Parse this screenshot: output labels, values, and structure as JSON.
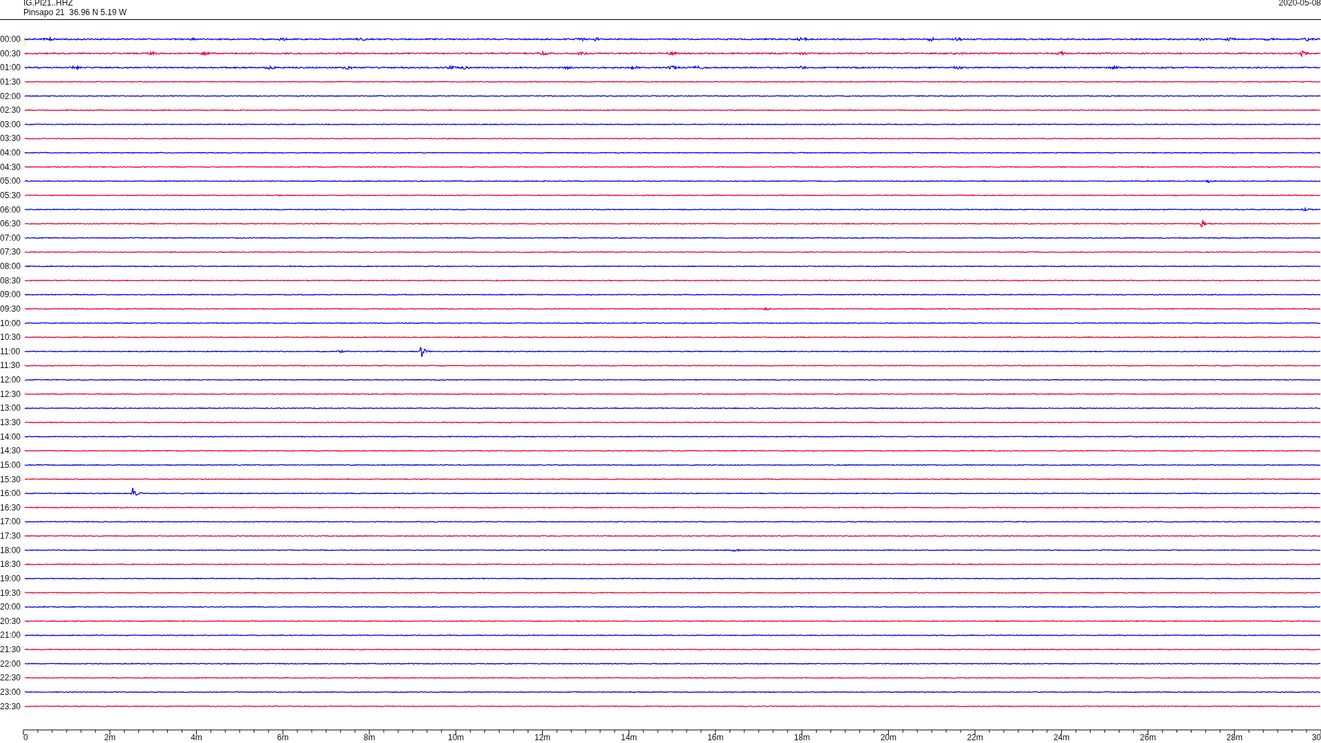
{
  "header": {
    "channel": "IG.PI21..HHZ",
    "station": "Pinsapo 21  36.96 N 5.19 W",
    "date": "2020-05-08"
  },
  "rows": [
    {
      "label": "00:00",
      "color": "#0000ee"
    },
    {
      "label": "00:30",
      "color": "#ee0033"
    },
    {
      "label": "01:00",
      "color": "#0000ee"
    },
    {
      "label": "01:30",
      "color": "#ee0033"
    },
    {
      "label": "02:00",
      "color": "#0000ee"
    },
    {
      "label": "02:30",
      "color": "#ee0033"
    },
    {
      "label": "03:00",
      "color": "#0000ee"
    },
    {
      "label": "03:30",
      "color": "#ee0033"
    },
    {
      "label": "04:00",
      "color": "#0000ee"
    },
    {
      "label": "04:30",
      "color": "#ee0033"
    },
    {
      "label": "05:00",
      "color": "#0000ee"
    },
    {
      "label": "05:30",
      "color": "#ee0033"
    },
    {
      "label": "06:00",
      "color": "#0000ee"
    },
    {
      "label": "06:30",
      "color": "#ee0033"
    },
    {
      "label": "07:00",
      "color": "#0000ee"
    },
    {
      "label": "07:30",
      "color": "#ee0033"
    },
    {
      "label": "08:00",
      "color": "#0000ee"
    },
    {
      "label": "08:30",
      "color": "#ee0033"
    },
    {
      "label": "09:00",
      "color": "#0000ee"
    },
    {
      "label": "09:30",
      "color": "#ee0033"
    },
    {
      "label": "10:00",
      "color": "#0000ee"
    },
    {
      "label": "10:30",
      "color": "#ee0033"
    },
    {
      "label": "11:00",
      "color": "#0000ee"
    },
    {
      "label": "11:30",
      "color": "#ee0033"
    },
    {
      "label": "12:00",
      "color": "#0000ee"
    },
    {
      "label": "12:30",
      "color": "#ee0033"
    },
    {
      "label": "13:00",
      "color": "#0000ee"
    },
    {
      "label": "13:30",
      "color": "#ee0033"
    },
    {
      "label": "14:00",
      "color": "#0000ee"
    },
    {
      "label": "14:30",
      "color": "#ee0033"
    },
    {
      "label": "15:00",
      "color": "#0000ee"
    },
    {
      "label": "15:30",
      "color": "#ee0033"
    },
    {
      "label": "16:00",
      "color": "#0000ee"
    },
    {
      "label": "16:30",
      "color": "#ee0033"
    },
    {
      "label": "17:00",
      "color": "#0000ee"
    },
    {
      "label": "17:30",
      "color": "#ee0033"
    },
    {
      "label": "18:00",
      "color": "#0000ee"
    },
    {
      "label": "18:30",
      "color": "#ee0033"
    },
    {
      "label": "19:00",
      "color": "#0000ee"
    },
    {
      "label": "19:30",
      "color": "#ee0033"
    },
    {
      "label": "20:00",
      "color": "#0000ee"
    },
    {
      "label": "20:30",
      "color": "#ee0033"
    },
    {
      "label": "21:00",
      "color": "#0000ee"
    },
    {
      "label": "21:30",
      "color": "#ee0033"
    },
    {
      "label": "22:00",
      "color": "#0000ee"
    },
    {
      "label": "22:30",
      "color": "#ee0033"
    },
    {
      "label": "23:00",
      "color": "#0000ee"
    },
    {
      "label": "23:30",
      "color": "#ee0033"
    }
  ],
  "x_axis": {
    "ticks": [
      "0",
      "2m",
      "4m",
      "6m",
      "8m",
      "10m",
      "12m",
      "14m",
      "16m",
      "18m",
      "20m",
      "22m",
      "24m",
      "26m",
      "28m",
      "30"
    ]
  }
}
